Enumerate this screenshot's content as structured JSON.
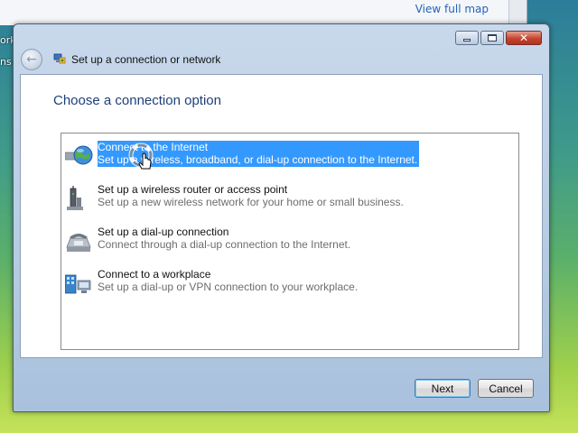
{
  "background": {
    "link": "View full map",
    "desktop_text_1": "ork",
    "desktop_text_2": "ns"
  },
  "window": {
    "title": "Set up a connection or network",
    "heading": "Choose a connection option",
    "options": [
      {
        "title": "Connect to the Internet",
        "description": "Set up a wireless, broadband, or dial-up connection to the Internet.",
        "icon": "globe-network-icon",
        "selected": true
      },
      {
        "title": "Set up a wireless router or access point",
        "description": "Set up a new wireless network for your home or small business.",
        "icon": "wireless-router-icon",
        "selected": false
      },
      {
        "title": "Set up a dial-up connection",
        "description": "Connect through a dial-up connection to the Internet.",
        "icon": "telephone-icon",
        "selected": false
      },
      {
        "title": "Connect to a workplace",
        "description": "Set up a dial-up or VPN connection to your workplace.",
        "icon": "workplace-network-icon",
        "selected": false
      }
    ],
    "buttons": {
      "next": "Next",
      "cancel": "Cancel"
    }
  },
  "colors": {
    "selection": "#3399ff",
    "heading": "#1e3f7a"
  }
}
